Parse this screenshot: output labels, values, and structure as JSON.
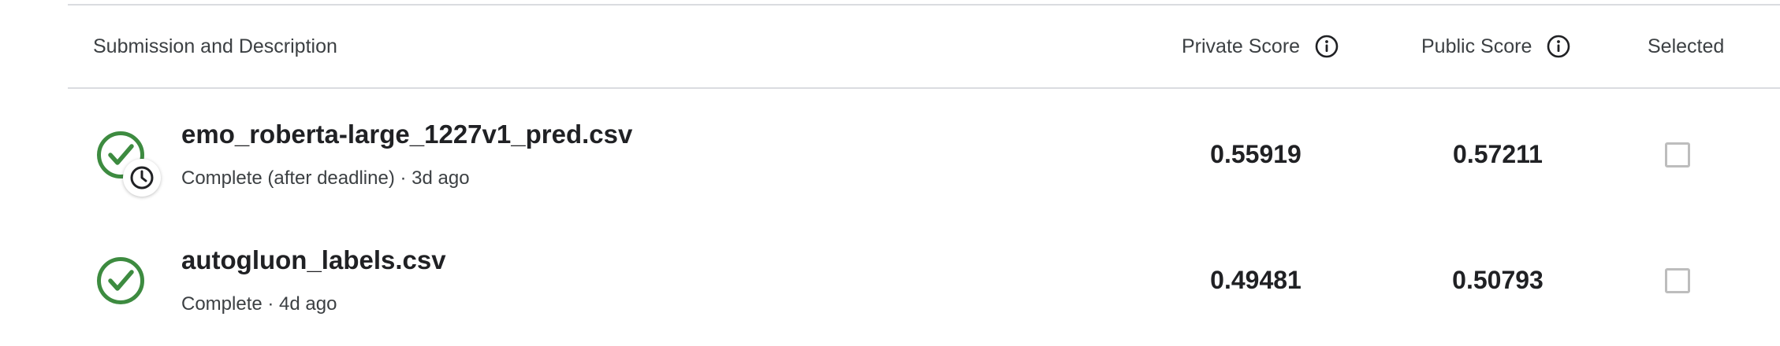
{
  "table": {
    "columns": {
      "submission": "Submission and Description",
      "private_score": "Private Score",
      "public_score": "Public Score",
      "selected": "Selected"
    },
    "rows": [
      {
        "filename": "emo_roberta-large_1227v1_pred.csv",
        "status": "Complete (after deadline) · 3d ago",
        "private_score": "0.55919",
        "public_score": "0.57211",
        "selected": false,
        "icon": "check-circle-icon",
        "badge_icon": "clock-icon"
      },
      {
        "filename": "autogluon_labels.csv",
        "status": "Complete · 4d ago",
        "private_score": "0.49481",
        "public_score": "0.50793",
        "selected": false,
        "icon": "check-circle-icon"
      }
    ]
  },
  "colors": {
    "success_green": "#3d8b40",
    "border": "#dadce0",
    "text": "#202124"
  }
}
